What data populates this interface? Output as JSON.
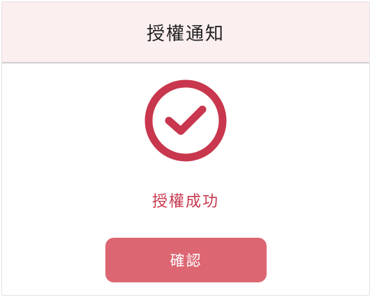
{
  "dialog": {
    "title": "授權通知",
    "icon": "check-circle-icon",
    "status_text": "授權成功",
    "confirm_label": "確認"
  },
  "colors": {
    "header_background": "#fbeff0",
    "accent": "#c8374d",
    "button_background": "#dc6672",
    "button_text": "#ffffff"
  }
}
